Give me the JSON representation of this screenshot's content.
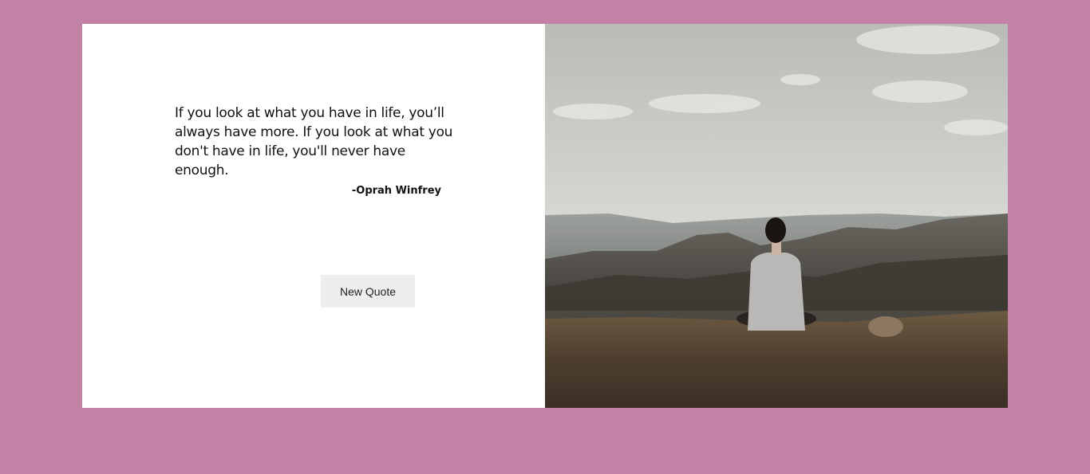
{
  "quote": {
    "text": "If you look at what you have in life, you’ll always have more. If you look at what you don't have in life, you'll never have enough.",
    "author": "-Oprah Winfrey"
  },
  "button": {
    "label": "New Quote"
  },
  "colors": {
    "page_background": "#c282a6",
    "card_background": "#ffffff",
    "button_background": "#eeeeee"
  },
  "image": {
    "subject": "landscape-photo"
  }
}
